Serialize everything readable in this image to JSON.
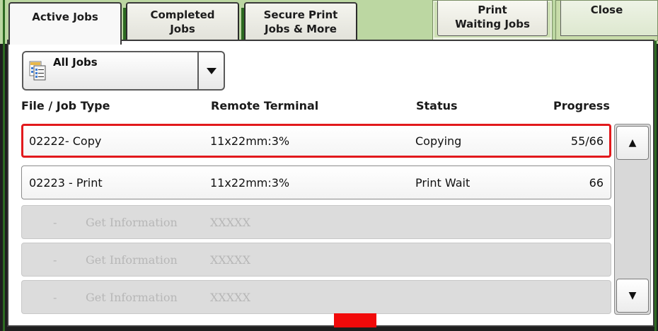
{
  "tabs": {
    "active_jobs": "Active Jobs",
    "completed_jobs": "Completed\nJobs",
    "secure_print": "Secure Print\nJobs & More"
  },
  "buttons": {
    "print_waiting_jobs": "Print\nWaiting Jobs",
    "close": "Close"
  },
  "filter": {
    "selected": "All Jobs",
    "icon": "job-list-icon",
    "arrow_icon": "triangle-down-icon"
  },
  "table": {
    "headers": {
      "job": "File / Job Type",
      "terminal": "Remote Terminal",
      "status": "Status",
      "progress": "Progress"
    },
    "rows": [
      {
        "job": "02222- Copy",
        "terminal": "11x22mm:3%",
        "status": "Copying",
        "progress": "55/66"
      },
      {
        "job": "02223 - Print",
        "terminal": "11x22mm:3%",
        "status": "Print Wait",
        "progress": "66"
      }
    ],
    "placeholder_rows": [
      {
        "dash": "-",
        "info": "Get Information",
        "terminal": "XXXXX"
      },
      {
        "dash": "-",
        "info": "Get Information",
        "terminal": "XXXXX"
      },
      {
        "dash": "-",
        "info": "Get Information",
        "terminal": "XXXXX"
      }
    ]
  },
  "scroll": {
    "up_icon": "triangle-up-icon",
    "down_icon": "triangle-down-icon",
    "up_glyph": "▲",
    "down_glyph": "▼"
  },
  "colors": {
    "selection": "#e2191c",
    "frame_green": "#2c6a21",
    "band_green": "#bcd7a2",
    "marker_red": "#f10a0a"
  }
}
